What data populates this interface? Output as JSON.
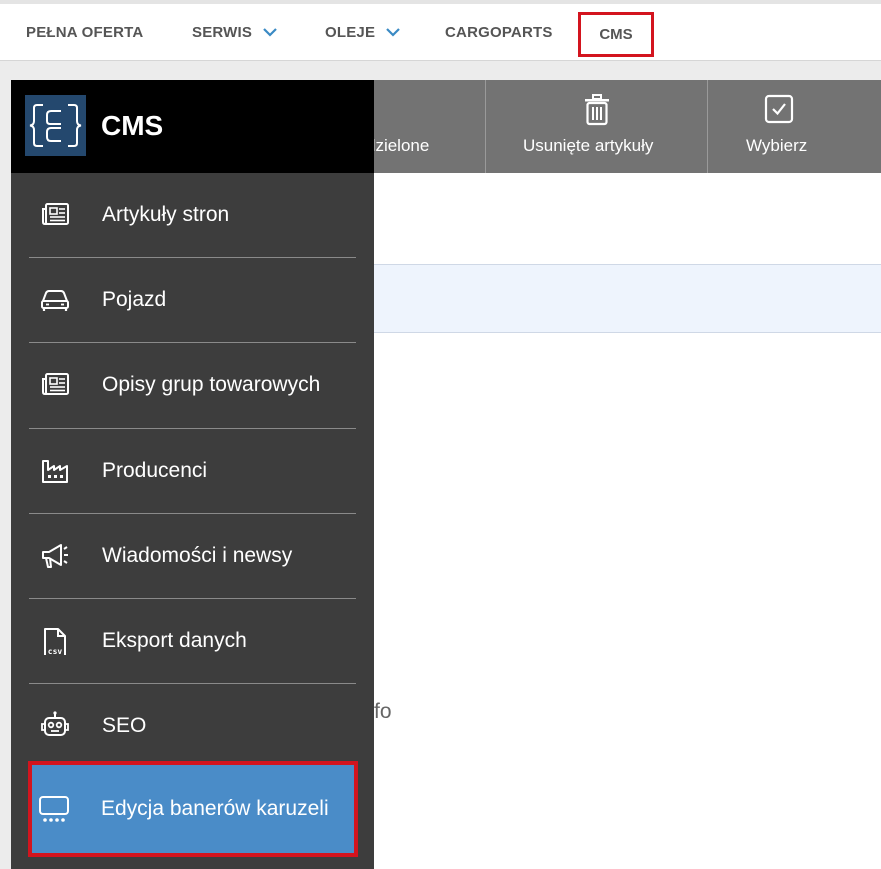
{
  "topnav": {
    "items": [
      {
        "label": "PEŁNA OFERTA"
      },
      {
        "label": "SERWIS"
      },
      {
        "label": "OLEJE"
      },
      {
        "label": "CARGOPARTS"
      },
      {
        "label": "CMS"
      }
    ]
  },
  "toolbar": {
    "partial_label": "dzielone",
    "deleted_label": "Usunięte artykuły",
    "select_label": "Wybierz"
  },
  "content": {
    "partial_text": "fo"
  },
  "drawer": {
    "title": "CMS",
    "items": [
      {
        "label": "Artykuły stron",
        "icon": "newspaper-icon"
      },
      {
        "label": "Pojazd",
        "icon": "car-icon"
      },
      {
        "label": "Opisy grup towarowych",
        "icon": "newspaper-icon"
      },
      {
        "label": "Producenci",
        "icon": "factory-icon"
      },
      {
        "label": "Wiadomości i newsy",
        "icon": "megaphone-icon"
      },
      {
        "label": "Eksport danych",
        "icon": "csv-file-icon"
      },
      {
        "label": "SEO",
        "icon": "robot-icon"
      },
      {
        "label": "Edycja banerów karuzeli",
        "icon": "carousel-icon",
        "active": true
      }
    ]
  },
  "colors": {
    "highlight_border": "#d3141e",
    "active_item_bg": "#4a8cc8",
    "drawer_bg": "#3d3d3d",
    "toolbar_bg": "#737373"
  }
}
